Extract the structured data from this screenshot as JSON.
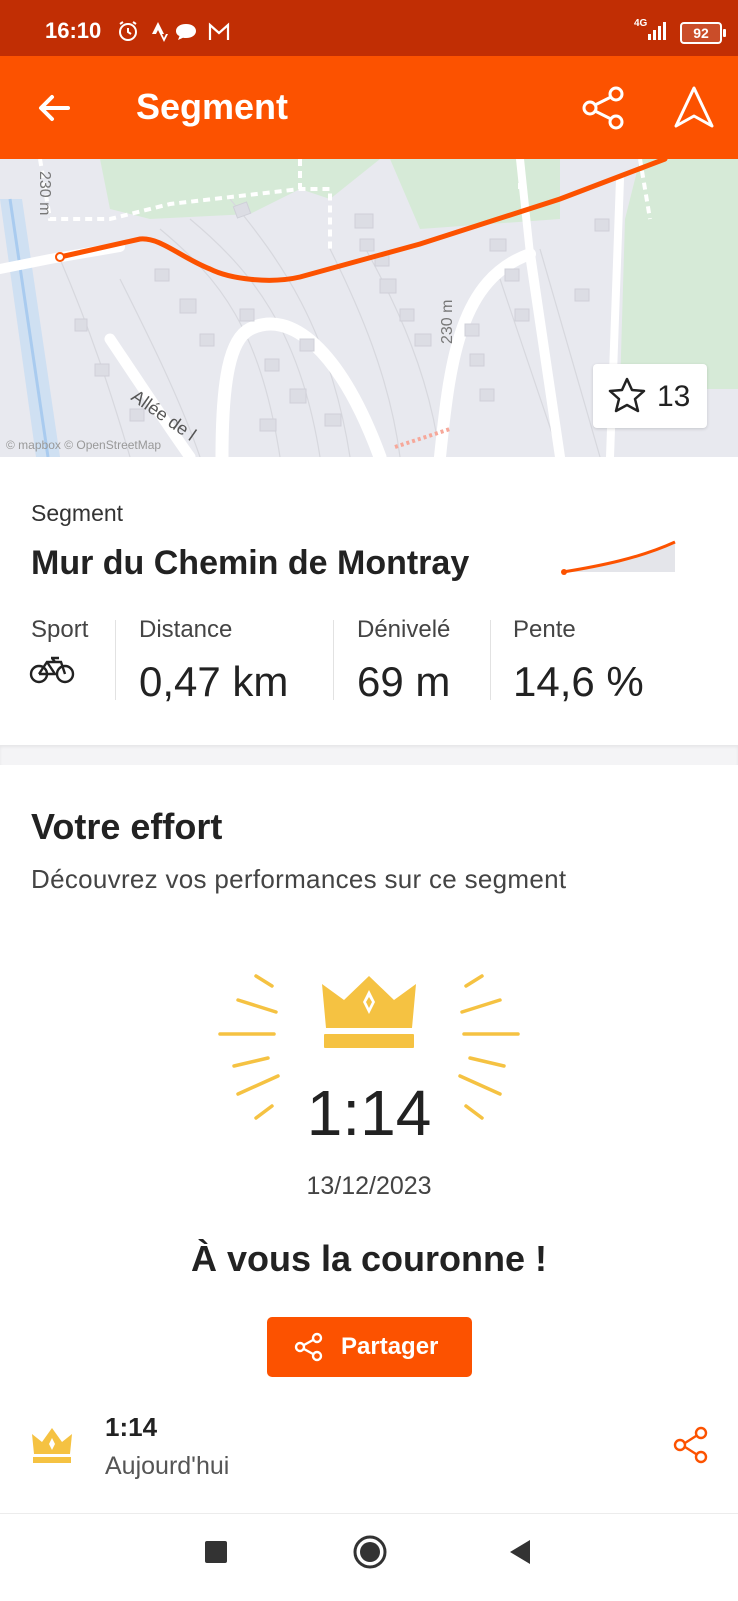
{
  "status_bar": {
    "time": "16:10",
    "network": "4G",
    "battery": "92",
    "icons": [
      "alarm-icon",
      "strava-notification-icon",
      "message-icon",
      "gmail-icon",
      "signal-icon",
      "battery-icon"
    ]
  },
  "app_bar": {
    "title": "Segment",
    "icons": [
      "back-arrow-icon",
      "share-icon",
      "navigation-icon"
    ]
  },
  "map": {
    "star_count": "13",
    "attribution": "© mapbox © OpenStreetMap",
    "contour_labels": [
      "230 m",
      "230 m"
    ],
    "street_label": "Allée de l",
    "route_color": "#fc5200"
  },
  "segment": {
    "label": "Segment",
    "name": "Mur du Chemin de Montray",
    "stats": [
      {
        "label": "Sport",
        "value": "",
        "icon": "bike-icon"
      },
      {
        "label": "Distance",
        "value": "0,47 km"
      },
      {
        "label": "Dénivelé",
        "value": "69 m"
      },
      {
        "label": "Pente",
        "value": "14,6 %"
      }
    ]
  },
  "effort": {
    "title": "Votre effort",
    "subtitle": "Découvrez vos performances sur ce segment",
    "best_time": "1:14",
    "date": "13/12/2023",
    "crown_message": "À vous la couronne !",
    "share_label": "Partager",
    "crown_color": "#f5c242"
  },
  "history": [
    {
      "time": "1:14",
      "when": "Aujourd'hui"
    }
  ],
  "nav_bar": {
    "icons": [
      "recent-apps-icon",
      "home-icon",
      "back-icon"
    ]
  },
  "colors": {
    "brand": "#fc5200",
    "status_bar": "#c12e04"
  }
}
